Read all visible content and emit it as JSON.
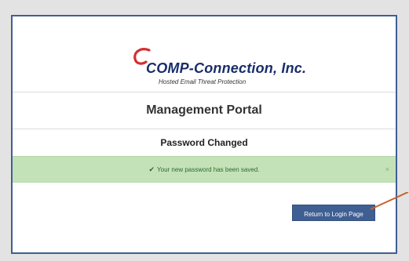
{
  "logo": {
    "company_name": "COMP-Connection, Inc.",
    "tagline": "Hosted Email Threat Protection"
  },
  "portal": {
    "title": "Management Portal",
    "section_title": "Password Changed"
  },
  "alert": {
    "message": "Your new password has been saved.",
    "close_glyph": "×",
    "check_glyph": "✔"
  },
  "actions": {
    "return_button_label": "Return to Login Page"
  },
  "colors": {
    "accent": "#3f5f93",
    "alert_bg": "#c4e2b7",
    "logo_red": "#d32f2f",
    "annotation_arrow": "#c7632e"
  }
}
